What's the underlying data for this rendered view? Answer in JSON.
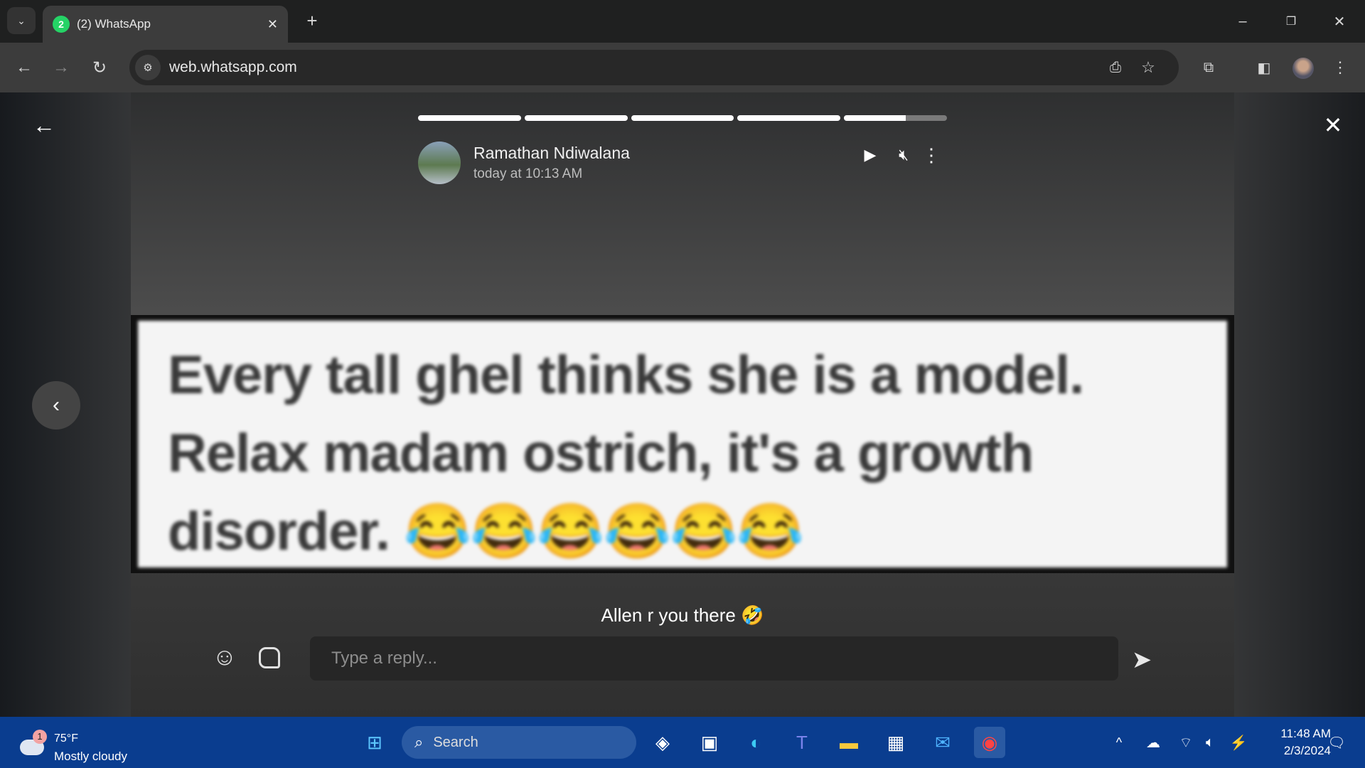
{
  "browser": {
    "tab_title": "(2) WhatsApp",
    "tab_badge": "2",
    "url": "web.whatsapp.com"
  },
  "status": {
    "progress_segments": [
      1,
      1,
      1,
      1,
      0.6
    ],
    "author": "Ramathan Ndiwalana",
    "time": "today at 10:13 AM",
    "image_text": [
      "Every tall ghel thinks she is a model.",
      "Relax madam ostrich, it's a growth",
      "disorder. 😂😂😂😂😂😂"
    ],
    "caption": "Allen r you there 🤣",
    "reply_placeholder": "Type a reply..."
  },
  "taskbar": {
    "weather_temp": "75°F",
    "weather_desc": "Mostly cloudy",
    "weather_badge": "1",
    "search": "Search",
    "time": "11:48 AM",
    "date": "2/3/2024"
  }
}
